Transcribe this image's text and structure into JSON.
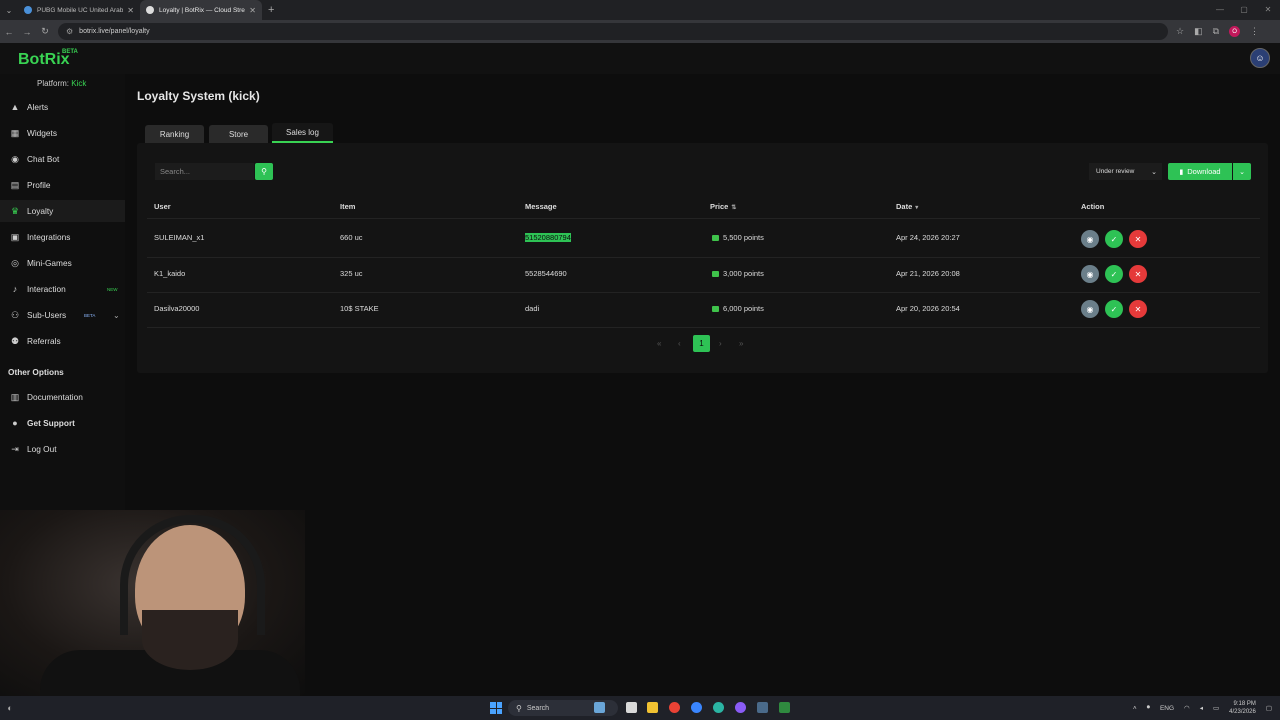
{
  "browser": {
    "tabs": [
      {
        "title": "PUBG Mobile UC United Arab E",
        "favicon_color": "#4a90d9",
        "active": false
      },
      {
        "title": "Loyalty | BotRix — Cloud Stream",
        "favicon_color": "#dddddd",
        "active": true
      }
    ],
    "url": "botrix.live/panel/loyalty",
    "profile_initial": "O"
  },
  "app": {
    "logo": "BotRix",
    "logo_badge": "BETA",
    "platform_label": "Platform:",
    "platform_value": "Kick"
  },
  "sidebar": {
    "items": [
      {
        "label": "Alerts",
        "icon": "warning-icon"
      },
      {
        "label": "Widgets",
        "icon": "grid-icon"
      },
      {
        "label": "Chat Bot",
        "icon": "robot-icon"
      },
      {
        "label": "Profile",
        "icon": "id-card-icon"
      },
      {
        "label": "Loyalty",
        "icon": "trophy-icon",
        "active": true
      },
      {
        "label": "Integrations",
        "icon": "puzzle-icon"
      },
      {
        "label": "Mini-Games",
        "icon": "gamepad-icon"
      },
      {
        "label": "Interaction",
        "icon": "music-icon",
        "badge": "NEW"
      },
      {
        "label": "Sub-Users",
        "icon": "users-icon",
        "badge": "BETA"
      },
      {
        "label": "Referrals",
        "icon": "people-icon"
      }
    ],
    "other_title": "Other Options",
    "other_items": [
      {
        "label": "Documentation",
        "icon": "book-icon"
      },
      {
        "label": "Get Support",
        "icon": "help-icon"
      },
      {
        "label": "Log Out",
        "icon": "logout-icon"
      }
    ]
  },
  "page": {
    "title": "Loyalty System (kick)",
    "tabs": [
      "Ranking",
      "Store",
      "Sales log"
    ],
    "active_tab": "Sales log"
  },
  "toolbar": {
    "search_placeholder": "Search...",
    "status_filter": "Under review",
    "download_label": "Download"
  },
  "table": {
    "headers": [
      "User",
      "Item",
      "Message",
      "Price",
      "Date",
      "Action"
    ],
    "rows": [
      {
        "user": "SULEIMAN_x1",
        "item": "660 uc",
        "message": "51520880794",
        "price": "5,500 points",
        "date": "Apr 24, 2026 20:27"
      },
      {
        "user": "K1_kaido",
        "item": "325 uc",
        "message": "5528544690",
        "price": "3,000 points",
        "date": "Apr 21, 2026 20:08"
      },
      {
        "user": "Dasilva20000",
        "item": "10$ STAKE",
        "message": "dadi",
        "price": "6,000 points",
        "date": "Apr 20, 2026 20:54"
      }
    ]
  },
  "pagination": {
    "first": "«",
    "prev": "‹",
    "current": "1",
    "next": "›",
    "last": "»"
  },
  "taskbar": {
    "search_label": "Search",
    "language": "ENG",
    "time": "9:18 PM",
    "date": "4/23/2026"
  },
  "colors": {
    "accent": "#2ec255",
    "danger": "#e53a3a",
    "view": "#6b7f8a"
  }
}
